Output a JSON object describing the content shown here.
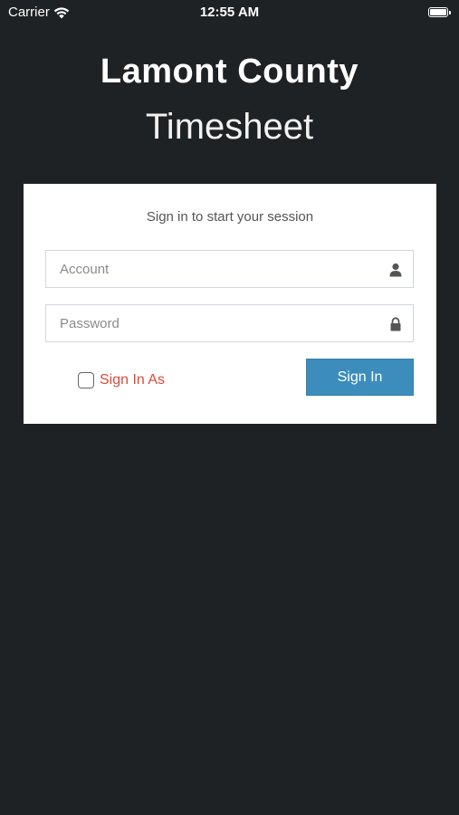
{
  "status_bar": {
    "carrier": "Carrier",
    "time": "12:55 AM"
  },
  "header": {
    "title": "Lamont County",
    "subtitle": "Timesheet"
  },
  "login": {
    "prompt": "Sign in to start your session",
    "account_placeholder": "Account",
    "account_value": "",
    "password_placeholder": "Password",
    "password_value": "",
    "sign_in_as_label": "Sign In As",
    "sign_in_as_checked": false,
    "sign_in_button": "Sign In"
  },
  "icons": {
    "account": "user-icon",
    "password": "lock-icon",
    "wifi": "wifi-icon",
    "battery": "battery-icon"
  },
  "colors": {
    "background": "#1f2225",
    "card": "#ffffff",
    "accent": "#3c8dbc",
    "sign_in_as_text": "#dd4b39"
  }
}
